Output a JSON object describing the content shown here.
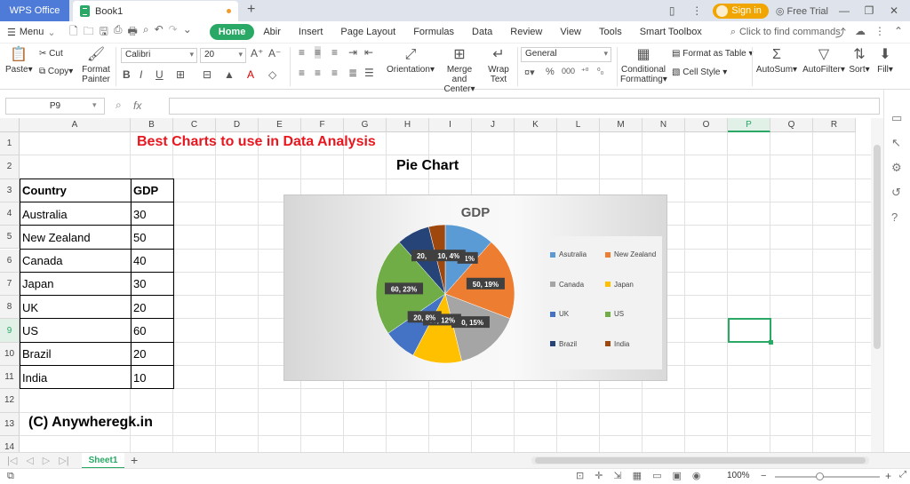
{
  "window": {
    "app_tab": "WPS Office",
    "doc_tab": "Book1",
    "sign_in": "Sign in",
    "free_trial": "Free Trial"
  },
  "menu": {
    "menu_label": "Menu",
    "tabs": [
      "Home",
      "Abir",
      "Insert",
      "Page Layout",
      "Formulas",
      "Data",
      "Review",
      "View",
      "Tools",
      "Smart Toolbox"
    ],
    "search": "Click to find commands"
  },
  "ribbon": {
    "paste": "Paste",
    "cut": "Cut",
    "copy": "Copy",
    "format_painter_1": "Format",
    "format_painter_2": "Painter",
    "font": "Calibri",
    "size": "20",
    "orientation": "Orientation",
    "merge_1": "Merge and",
    "merge_2": "Center",
    "wrap_1": "Wrap",
    "wrap_2": "Text",
    "number_format": "General",
    "cond_1": "Conditional",
    "cond_2": "Formatting",
    "format_table": "Format as Table",
    "cell_style": "Cell Style",
    "autosum": "AutoSum",
    "autofilter": "AutoFilter",
    "sort": "Sort",
    "fill": "Fill"
  },
  "formula": {
    "name_box": "P9",
    "fx": "fx"
  },
  "columns": [
    "A",
    "B",
    "C",
    "D",
    "E",
    "F",
    "G",
    "H",
    "I",
    "J",
    "K",
    "L",
    "M",
    "N",
    "O",
    "P",
    "Q",
    "R"
  ],
  "rows": [
    "1",
    "2",
    "3",
    "4",
    "5",
    "6",
    "7",
    "8",
    "9",
    "10",
    "11",
    "12",
    "13",
    "14"
  ],
  "sheet": {
    "title": "Best Charts to use in Data Analysis",
    "subtitle": "Pie Chart",
    "header": {
      "country": "Country",
      "gdp": "GDP"
    },
    "table": [
      {
        "country": "Australia",
        "gdp": "30"
      },
      {
        "country": "New Zealand",
        "gdp": "50"
      },
      {
        "country": "Canada",
        "gdp": "40"
      },
      {
        "country": "Japan",
        "gdp": "30"
      },
      {
        "country": "UK",
        "gdp": "20"
      },
      {
        "country": "US",
        "gdp": "60"
      },
      {
        "country": "Brazil",
        "gdp": "20"
      },
      {
        "country": "India",
        "gdp": "10"
      }
    ],
    "copyright": "(C) Anywheregk.in"
  },
  "chart_data": {
    "type": "pie",
    "title": "GDP",
    "categories": [
      "Asutralia",
      "New Zealand",
      "Canada",
      "Japan",
      "UK",
      "US",
      "Brazil",
      "India"
    ],
    "values": [
      30,
      50,
      40,
      30,
      20,
      60,
      20,
      10
    ],
    "data_labels": [
      "11%",
      "50, 19%",
      "40, 15%",
      "30, 12%",
      "20, 8%",
      "60, 23%",
      "20,",
      "10, 4%"
    ],
    "colors": [
      "#5b9bd5",
      "#ed7d31",
      "#a5a5a5",
      "#ffc000",
      "#4472c4",
      "#70ad47",
      "#264478",
      "#9e480e"
    ],
    "legend_position": "right"
  },
  "tabs_bottom": {
    "sheet1": "Sheet1"
  },
  "status": {
    "zoom": "100%"
  }
}
